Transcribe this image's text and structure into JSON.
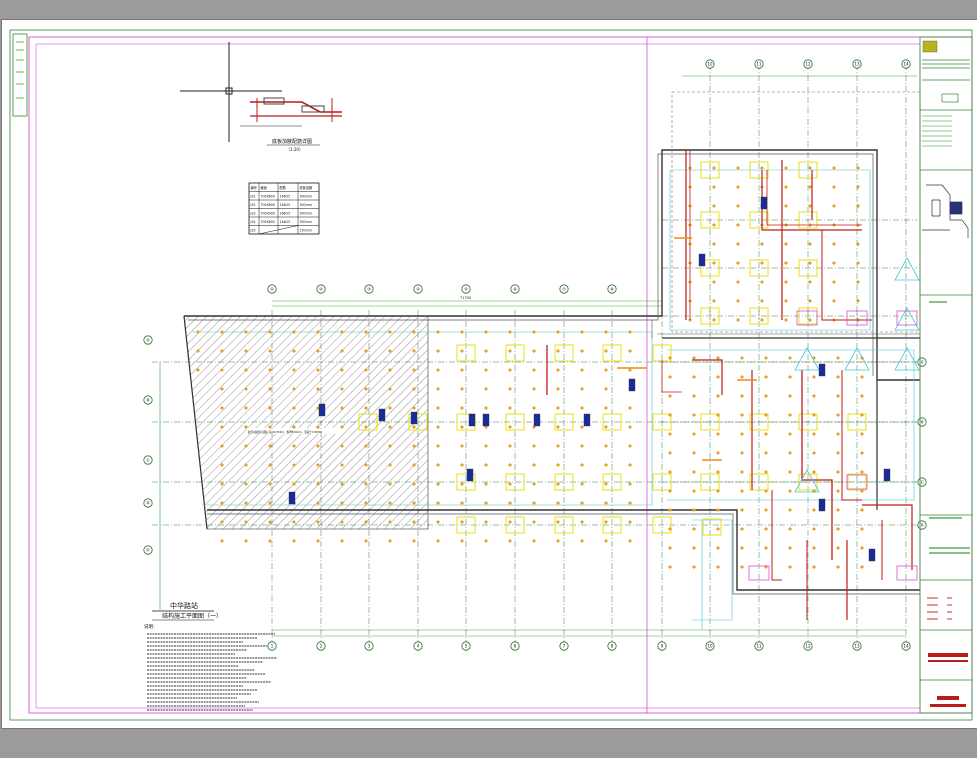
{
  "drawing": {
    "title_main": "中华路站",
    "title_sub": "结构施工平面图（一）",
    "detail_title": "底板加腋配筋详图",
    "detail_scale": "（1:20）",
    "notes_heading": "说明：",
    "area_note": "此区域底板顶面标高-14.550m，板厚800mm，混凝土C35P10",
    "column_grid_top": [
      "①",
      "②",
      "③",
      "④",
      "⑤",
      "⑥",
      "⑦",
      "⑧"
    ],
    "row_grid_left": [
      "Ⓐ",
      "Ⓑ",
      "Ⓒ",
      "Ⓓ",
      "Ⓔ"
    ],
    "dimension_total": "71700",
    "table": {
      "headers": [
        "编号",
        "截面",
        "配筋",
        "底板加腋"
      ],
      "rows": [
        [
          "JS1",
          "700X800",
          "14Φ25",
          "300mm"
        ],
        [
          "JS2",
          "700X800",
          "14Φ25",
          "300mm"
        ],
        [
          "JS3",
          "700X900",
          "16Φ25",
          "300mm"
        ],
        [
          "JS4",
          "700X800",
          "14Φ25",
          "300mm"
        ],
        [
          "JS5",
          "",
          "",
          "150mm"
        ]
      ]
    },
    "title_block": {
      "company": "设计院",
      "stage": "施工图",
      "drawing_no": "结施-01"
    }
  },
  "colors": {
    "background": "#9b9b9b",
    "sheet": "#ffffff",
    "border_magenta": "#d74fd7",
    "grid_green": "#2f8a2f",
    "column_yellow": "#e7e21a",
    "pile_orange": "#e8a022",
    "pipe_red": "#c11a1a",
    "wall_cyan": "#49c6d8",
    "hatch": "#7a7a7a",
    "dim_green": "#3da83d"
  }
}
